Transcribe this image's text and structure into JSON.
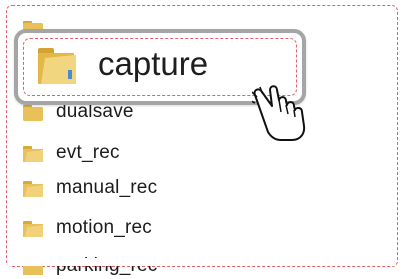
{
  "folder_list": {
    "items": [
      {
        "label": "dualsave"
      },
      {
        "label": "evt_rec"
      },
      {
        "label": "manual_rec"
      },
      {
        "label": "motion_rec"
      },
      {
        "label": "parking_rec"
      }
    ]
  },
  "highlight": {
    "label": "capture"
  },
  "icons": {
    "folder": "folder-icon",
    "cursor": "hand-pointer-icon"
  },
  "colors": {
    "folder_yellow": "#e8c15a",
    "dashed_border": "#e0606a",
    "highlight_border": "#a5a5a5"
  }
}
